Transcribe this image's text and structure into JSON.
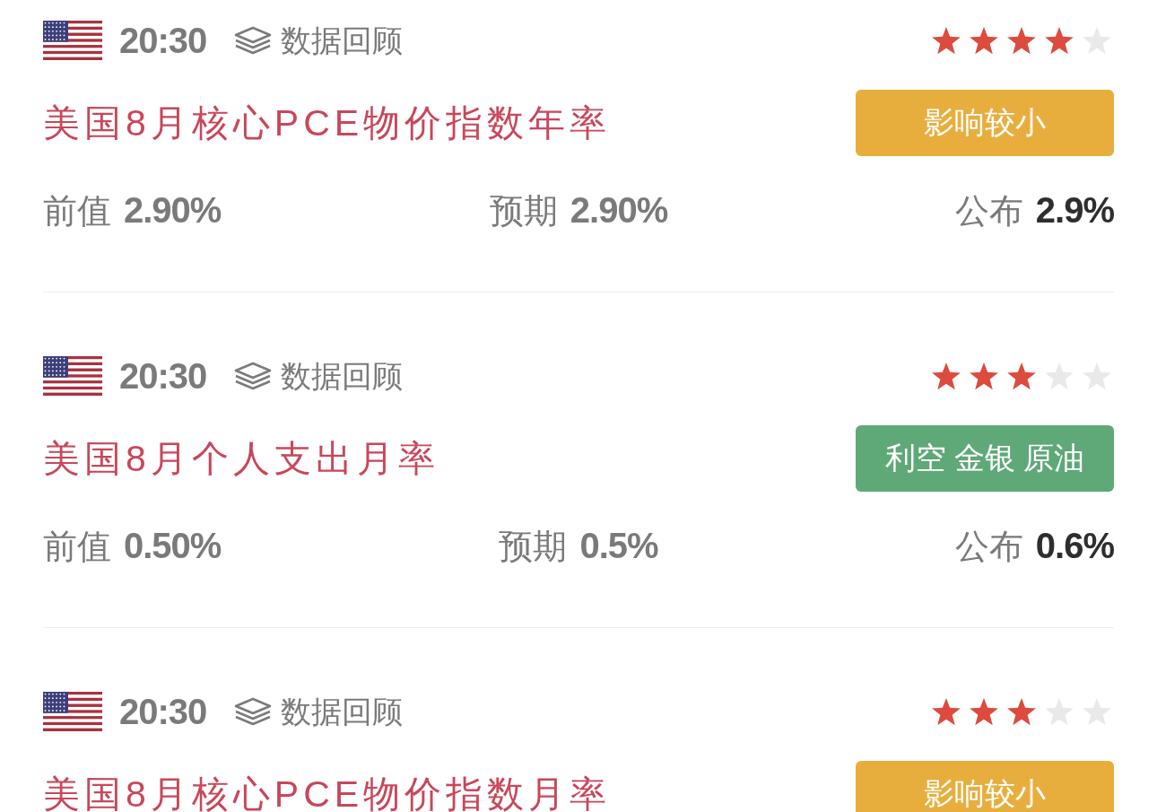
{
  "events": [
    {
      "time": "20:30",
      "review_link": "数据回顾",
      "stars": 4,
      "title": "美国8月核心PCE物价指数年率",
      "tag": {
        "text": "影响较小",
        "color": "#e8ae3d"
      },
      "figures": [
        {
          "kind": "previous",
          "label": "前值",
          "value": "2.90%"
        },
        {
          "kind": "forecast",
          "label": "预期",
          "value": "2.90%"
        },
        {
          "kind": "actual",
          "label": "公布",
          "value": "2.9%"
        }
      ]
    },
    {
      "time": "20:30",
      "review_link": "数据回顾",
      "stars": 3,
      "title": "美国8月个人支出月率",
      "tag": {
        "text": "利空 金银 原油",
        "color": "#5fa878"
      },
      "figures": [
        {
          "kind": "previous",
          "label": "前值",
          "value": "0.50%"
        },
        {
          "kind": "forecast",
          "label": "预期",
          "value": "0.5%"
        },
        {
          "kind": "actual",
          "label": "公布",
          "value": "0.6%"
        }
      ]
    },
    {
      "time": "20:30",
      "review_link": "数据回顾",
      "stars": 3,
      "title": "美国8月核心PCE物价指数月率",
      "tag": {
        "text": "影响较小",
        "color": "#e8ae3d"
      }
    }
  ]
}
